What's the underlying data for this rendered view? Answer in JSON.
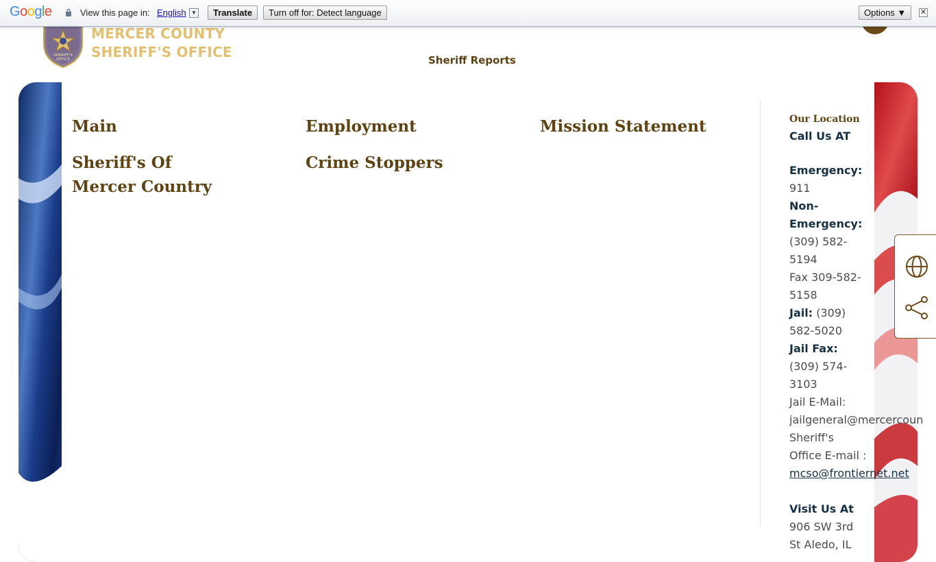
{
  "translate_bar": {
    "logo": "Google",
    "label": "View this page in:",
    "language": "English",
    "translate_button": "Translate",
    "turn_off_button": "Turn off for: Detect language",
    "options_button": "Options ▼",
    "close": "✕"
  },
  "header": {
    "site_name_line1": "MERCER COUNTY",
    "site_name_line2": "SHERIFF'S OFFICE",
    "badge_text_1": "SHERIFF'S",
    "badge_text_2": "OFFICE",
    "nav_sheriff_reports": "Sheriff Reports"
  },
  "menu": {
    "items": [
      {
        "label": "Main"
      },
      {
        "label": "Employment"
      },
      {
        "label": "Mission Statement"
      },
      {
        "label": "Sheriff's Of Mercer Country"
      },
      {
        "label": "Crime Stoppers"
      }
    ]
  },
  "contact": {
    "heading": "Our Location",
    "call_us": "Call Us AT",
    "emergency_label": "Emergency:",
    "emergency_value": "911",
    "non_emergency_label": "Non-Emergency:",
    "non_emergency_value": "(309) 582-5194",
    "fax": "Fax 309-582-5158",
    "jail_label": "Jail:",
    "jail_value": "(309) 582-5020",
    "jail_fax_label": "Jail Fax:",
    "jail_fax_value": "(309) 574-3103",
    "jail_email_label": "Jail E-Mail:",
    "jail_email_value": "jailgeneral@mercercoun",
    "office_email_label": "Sheriff's Office E-mail :",
    "office_email_value": "mcso@frontiernet.net",
    "visit_label": "Visit Us At",
    "address_line1": "906 SW 3rd",
    "address_line2": "St Aledo, IL"
  },
  "colors": {
    "brand_brown": "#5e4313",
    "brand_gold": "#e3c070",
    "contact_navy": "#163044"
  },
  "icons": {
    "globe": "globe-icon",
    "share": "share-icon",
    "lock": "lock-icon"
  }
}
